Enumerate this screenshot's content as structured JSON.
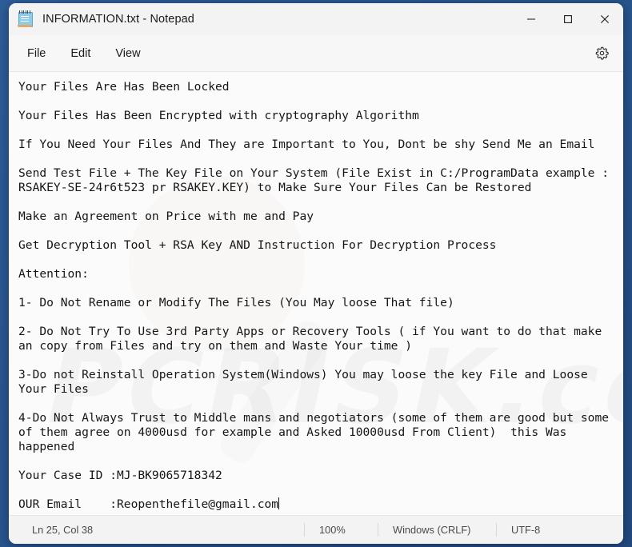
{
  "window": {
    "title": "INFORMATION.txt - Notepad",
    "app_icon": "notepad-icon",
    "controls": {
      "minimize": "minimize-icon",
      "maximize": "maximize-icon",
      "close": "close-icon"
    }
  },
  "menubar": {
    "items": [
      {
        "label": "File"
      },
      {
        "label": "Edit"
      },
      {
        "label": "View"
      }
    ],
    "settings_icon": "gear-icon"
  },
  "editor": {
    "content": "Your Files Are Has Been Locked\n\nYour Files Has Been Encrypted with cryptography Algorithm\n\nIf You Need Your Files And They are Important to You, Dont be shy Send Me an Email\n\nSend Test File + The Key File on Your System (File Exist in C:/ProgramData example : RSAKEY-SE-24r6t523 pr RSAKEY.KEY) to Make Sure Your Files Can be Restored\n\nMake an Agreement on Price with me and Pay\n\nGet Decryption Tool + RSA Key AND Instruction For Decryption Process\n\nAttention:\n\n1- Do Not Rename or Modify The Files (You May loose That file)\n\n2- Do Not Try To Use 3rd Party Apps or Recovery Tools ( if You want to do that make an copy from Files and try on them and Waste Your time )\n\n3-Do not Reinstall Operation System(Windows) You may loose the key File and Loose Your Files\n\n4-Do Not Always Trust to Middle mans and negotiators (some of them are good but some of them agree on 4000usd for example and Asked 10000usd From Client)  this Was happened\n\nYour Case ID :MJ-BK9065718342\n\nOUR Email    :Reopenthefile@gmail.com",
    "watermark": "PCRISK.com"
  },
  "statusbar": {
    "line_col": "Ln 25, Col 38",
    "zoom": "100%",
    "line_ending": "Windows (CRLF)",
    "encoding": "UTF-8"
  },
  "colors": {
    "desktop": "#2a5a96",
    "window_chrome": "#f3f3f3",
    "editor_background": "#fbfbfb",
    "text": "#161616"
  }
}
